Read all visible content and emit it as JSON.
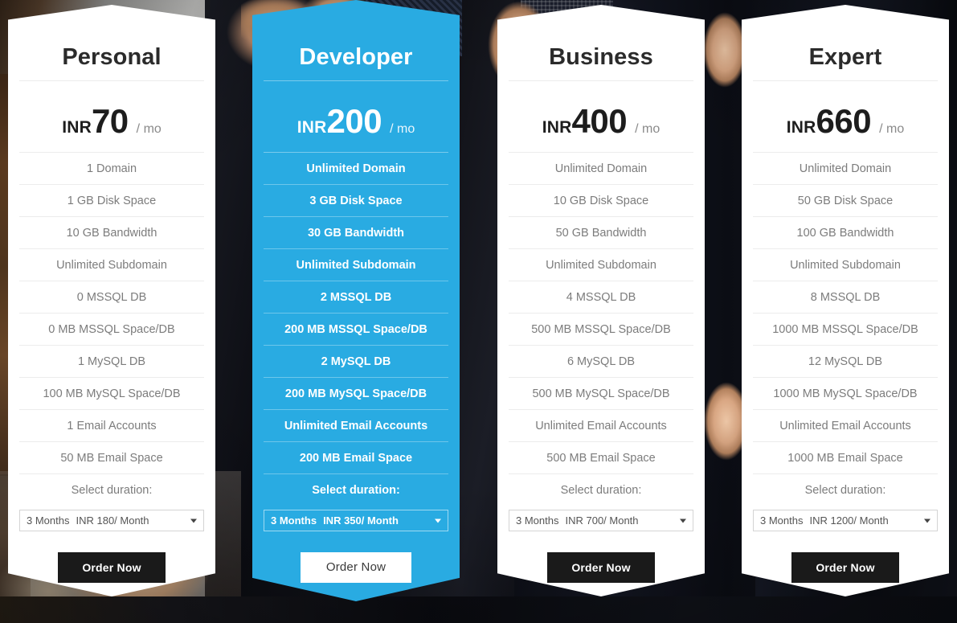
{
  "plans": [
    {
      "name": "Personal",
      "currency": "INR",
      "amount": "70",
      "period": "/ mo",
      "features": [
        "1 Domain",
        "1 GB Disk Space",
        "10 GB Bandwidth",
        "Unlimited Subdomain",
        "0 MSSQL DB",
        "0 MB MSSQL Space/DB",
        "1 MySQL DB",
        "100 MB MySQL Space/DB",
        "1 Email Accounts",
        "50 MB Email Space"
      ],
      "duration_label": "Select duration:",
      "duration_term": "3 Months",
      "duration_rate": "INR 180/ Month",
      "order_label": "Order Now"
    },
    {
      "name": "Developer",
      "currency": "INR",
      "amount": "200",
      "period": "/ mo",
      "features": [
        "Unlimited Domain",
        "3 GB Disk Space",
        "30 GB Bandwidth",
        "Unlimited Subdomain",
        "2 MSSQL DB",
        "200 MB MSSQL Space/DB",
        "2 MySQL DB",
        "200 MB MySQL Space/DB",
        "Unlimited Email Accounts",
        "200 MB Email Space"
      ],
      "duration_label": "Select duration:",
      "duration_term": "3 Months",
      "duration_rate": "INR 350/ Month",
      "order_label": "Order Now"
    },
    {
      "name": "Business",
      "currency": "INR",
      "amount": "400",
      "period": "/ mo",
      "features": [
        "Unlimited Domain",
        "10 GB Disk Space",
        "50 GB Bandwidth",
        "Unlimited Subdomain",
        "4 MSSQL DB",
        "500 MB MSSQL Space/DB",
        "6 MySQL DB",
        "500 MB MySQL Space/DB",
        "Unlimited Email Accounts",
        "500 MB Email Space"
      ],
      "duration_label": "Select duration:",
      "duration_term": "3 Months",
      "duration_rate": "INR 700/ Month",
      "order_label": "Order Now"
    },
    {
      "name": "Expert",
      "currency": "INR",
      "amount": "660",
      "period": "/ mo",
      "features": [
        "Unlimited Domain",
        "50 GB Disk Space",
        "100 GB Bandwidth",
        "Unlimited Subdomain",
        "8 MSSQL DB",
        "1000 MB MSSQL Space/DB",
        "12 MySQL DB",
        "1000 MB MySQL Space/DB",
        "Unlimited Email Accounts",
        "1000 MB Email Space"
      ],
      "duration_label": "Select duration:",
      "duration_term": "3 Months",
      "duration_rate": "INR 1200/ Month",
      "order_label": "Order Now"
    }
  ],
  "featured_index": 1,
  "colors": {
    "featured_background": "#29abe2",
    "card_background": "#ffffff",
    "order_button": "#1a1a1a",
    "feature_text": "#7c7c7c",
    "title_text": "#2b2b2b"
  },
  "icons": {
    "select_arrow": "chevron-down-icon"
  }
}
